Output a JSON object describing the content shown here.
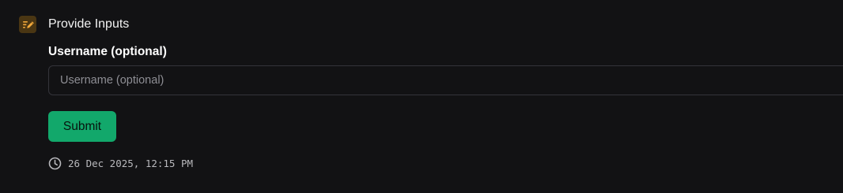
{
  "step": {
    "icon": "edit-form-icon",
    "title": "Provide Inputs"
  },
  "form": {
    "username": {
      "label": "Username (optional)",
      "placeholder": "Username (optional)",
      "value": ""
    },
    "submit_label": "Submit"
  },
  "meta": {
    "icon": "clock-icon",
    "timestamp": "26 Dec 2025, 12:15 PM"
  },
  "colors": {
    "background": "#121214",
    "icon_bg": "#4a3613",
    "icon_accent": "#f2a93b",
    "submit_bg": "#12a86b"
  }
}
